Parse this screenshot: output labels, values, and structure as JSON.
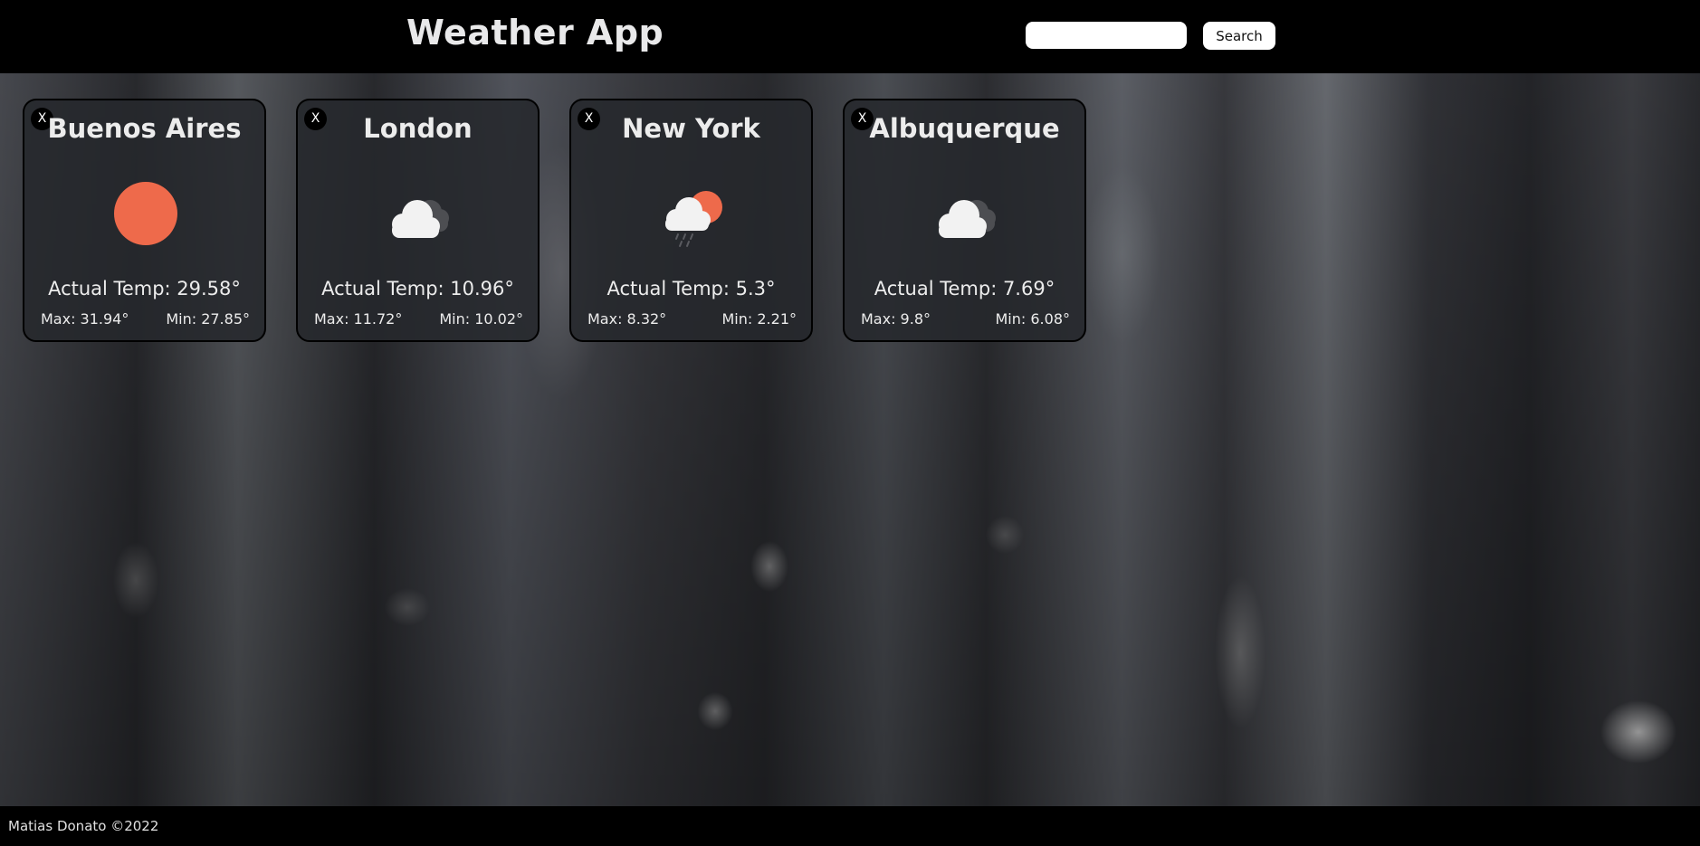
{
  "header": {
    "title": "Weather App",
    "search_placeholder": "",
    "search_value": "",
    "search_label": "Search"
  },
  "cards": [
    {
      "close_label": "X",
      "city": "Buenos Aires",
      "icon": "sun-icon",
      "actual": "Actual Temp: 29.58°",
      "max": "Max: 31.94°",
      "min": "Min: 27.85°"
    },
    {
      "close_label": "X",
      "city": "London",
      "icon": "cloudy-icon",
      "actual": "Actual Temp: 10.96°",
      "max": "Max: 11.72°",
      "min": "Min: 10.02°"
    },
    {
      "close_label": "X",
      "city": "New York",
      "icon": "rain-sun-icon",
      "actual": "Actual Temp: 5.3°",
      "max": "Max: 8.32°",
      "min": "Min: 2.21°"
    },
    {
      "close_label": "X",
      "city": "Albuquerque",
      "icon": "cloudy-icon",
      "actual": "Actual Temp: 7.69°",
      "max": "Max: 9.8°",
      "min": "Min: 6.08°"
    }
  ],
  "footer": {
    "text": "Matias Donato ©2022"
  },
  "colors": {
    "header_bg": "#000000",
    "card_bg": "#26282c",
    "sun": "#ee6a4b",
    "cloud_front": "#f2f2f2",
    "cloud_back": "#4d4e52"
  }
}
